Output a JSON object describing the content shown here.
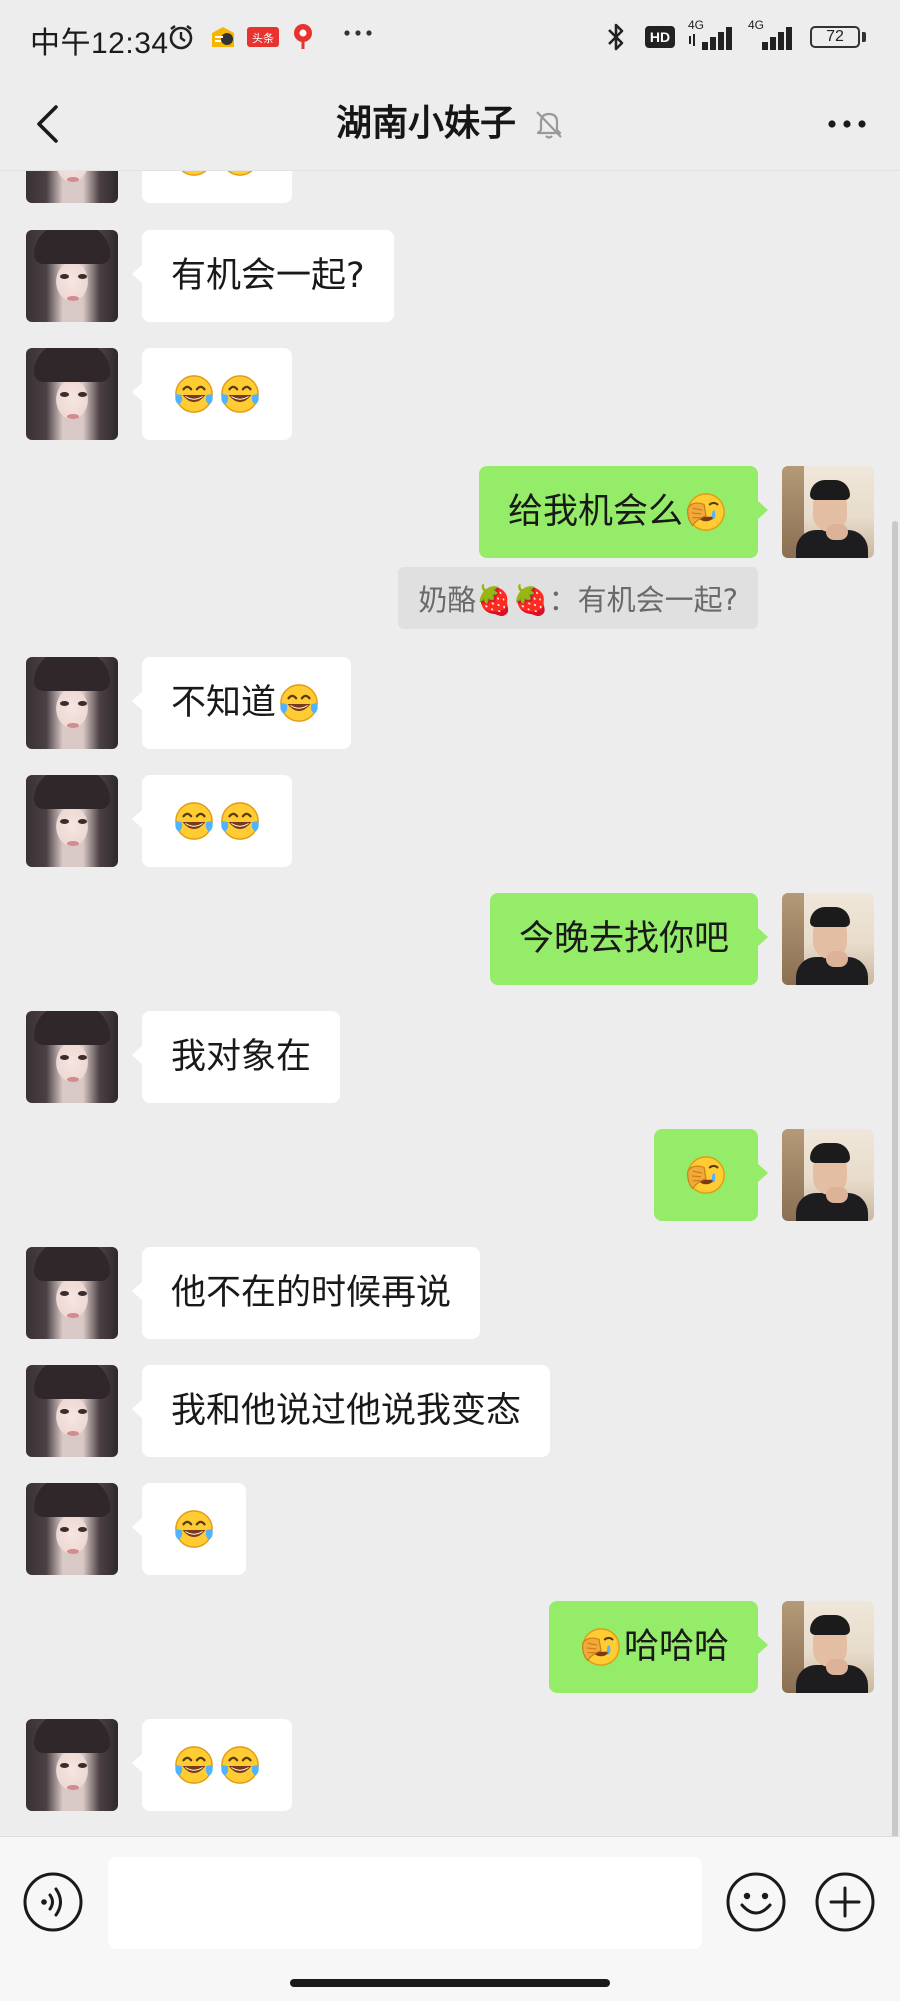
{
  "status_bar": {
    "time": "中午12:34",
    "icons": [
      "alarm-clock-icon",
      "app-notification-icon",
      "toutiao-icon",
      "map-pin-icon",
      "more-dots-icon",
      "bluetooth-icon",
      "hd-volte-icon",
      "signal-4g-icon",
      "signal-4g-icon",
      "battery-icon"
    ],
    "hd_label": "HD",
    "network_label_1": "4G",
    "network_label_2": "4G",
    "battery_level": "72"
  },
  "nav": {
    "title": "湖南小妹子",
    "back_icon": "chevron-left-icon",
    "mute_icon": "bell-muted-icon",
    "more_icon": "more-horizontal-icon"
  },
  "colors": {
    "background": "#ededed",
    "incoming_bubble": "#ffffff",
    "outgoing_bubble": "#95ec69",
    "quote_bubble": "#e0e0e0",
    "text": "#191919"
  },
  "messages": [
    {
      "side": "left",
      "text": "",
      "emoji": [
        "tears-of-joy",
        "tears-of-joy"
      ],
      "partial": true
    },
    {
      "side": "left",
      "text": "有机会一起?",
      "emoji": []
    },
    {
      "side": "left",
      "text": "",
      "emoji": [
        "tears-of-joy",
        "tears-of-joy"
      ]
    },
    {
      "side": "right",
      "text": "给我机会么",
      "emoji_after": [
        "facepalm"
      ]
    },
    {
      "side": "quote",
      "text": "奶酪🍓🍓：有机会一起?"
    },
    {
      "side": "left",
      "text": "不知道",
      "emoji_after": [
        "tears-of-joy"
      ]
    },
    {
      "side": "left",
      "text": "",
      "emoji": [
        "tears-of-joy",
        "tears-of-joy"
      ]
    },
    {
      "side": "right",
      "text": "今晚去找你吧",
      "emoji": []
    },
    {
      "side": "left",
      "text": "我对象在",
      "emoji": []
    },
    {
      "side": "right",
      "text": "",
      "emoji": [
        "facepalm"
      ]
    },
    {
      "side": "left",
      "text": "他不在的时候再说",
      "emoji": []
    },
    {
      "side": "left",
      "text": "我和他说过他说我变态",
      "emoji": []
    },
    {
      "side": "left",
      "text": "",
      "emoji": [
        "tears-of-joy"
      ]
    },
    {
      "side": "right",
      "text": "哈哈哈",
      "emoji_before": [
        "facepalm"
      ]
    },
    {
      "side": "left",
      "text": "",
      "emoji": [
        "tears-of-joy",
        "tears-of-joy"
      ]
    }
  ],
  "input_bar": {
    "voice_icon": "voice-input-icon",
    "input_value": "",
    "emoji_icon": "emoji-smile-icon",
    "plus_icon": "plus-circle-icon"
  }
}
